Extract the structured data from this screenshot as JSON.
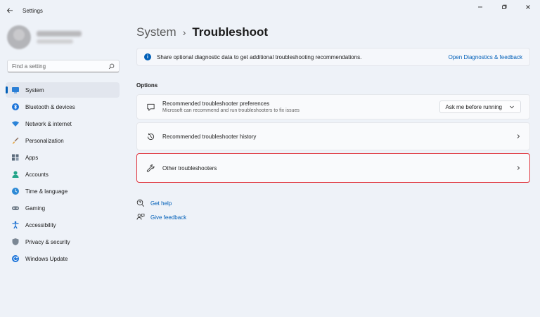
{
  "window": {
    "title": "Settings"
  },
  "sidebar": {
    "search_placeholder": "Find a setting",
    "items": [
      {
        "label": "System",
        "icon": "monitor-icon",
        "active": true
      },
      {
        "label": "Bluetooth & devices",
        "icon": "bluetooth-icon"
      },
      {
        "label": "Network & internet",
        "icon": "wifi-icon"
      },
      {
        "label": "Personalization",
        "icon": "brush-icon"
      },
      {
        "label": "Apps",
        "icon": "apps-icon"
      },
      {
        "label": "Accounts",
        "icon": "person-icon"
      },
      {
        "label": "Time & language",
        "icon": "globe-clock-icon"
      },
      {
        "label": "Gaming",
        "icon": "gamepad-icon"
      },
      {
        "label": "Accessibility",
        "icon": "accessibility-icon"
      },
      {
        "label": "Privacy & security",
        "icon": "shield-icon"
      },
      {
        "label": "Windows Update",
        "icon": "update-icon"
      }
    ]
  },
  "breadcrumb": {
    "parent": "System",
    "separator": "›",
    "current": "Troubleshoot"
  },
  "banner": {
    "text": "Share optional diagnostic data to get additional troubleshooting recommendations.",
    "link": "Open Diagnostics & feedback"
  },
  "options": {
    "label": "Options",
    "preferences": {
      "title": "Recommended troubleshooter preferences",
      "subtitle": "Microsoft can recommend and run troubleshooters to fix issues",
      "dropdown_value": "Ask me before running"
    },
    "history": {
      "title": "Recommended troubleshooter history"
    },
    "other": {
      "title": "Other troubleshooters"
    }
  },
  "links": {
    "get_help": "Get help",
    "give_feedback": "Give feedback"
  },
  "colors": {
    "accent": "#005fb8",
    "highlight_border": "#e0343d",
    "background": "#eef2f8"
  }
}
